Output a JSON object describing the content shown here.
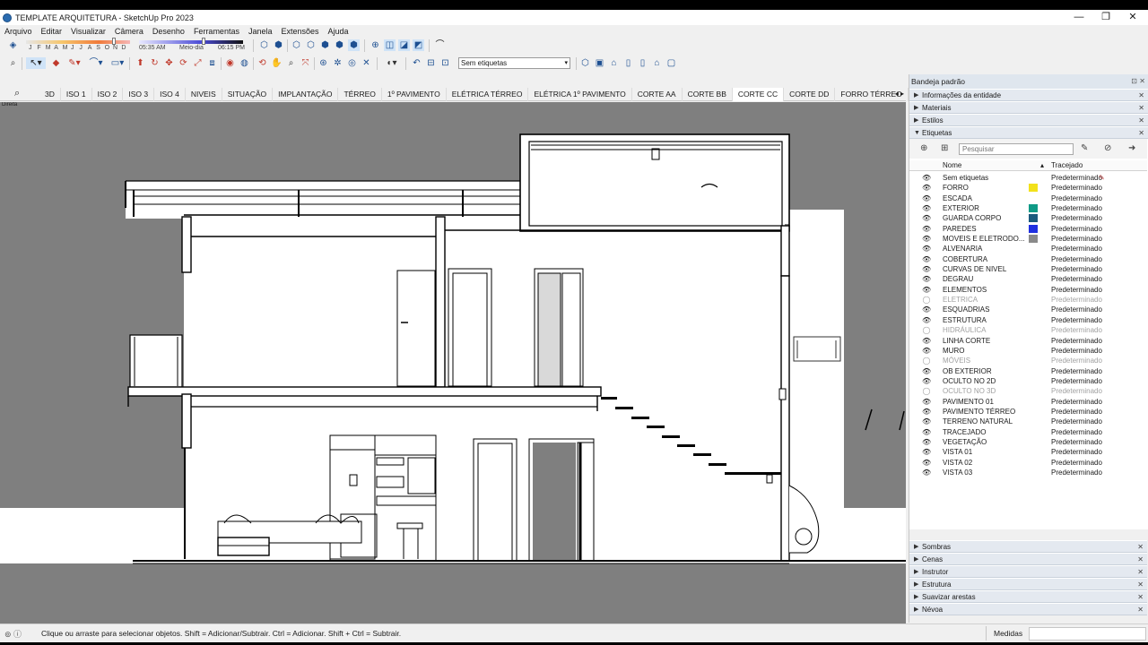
{
  "window": {
    "title": "TEMPLATE ARQUITETURA - SketchUp Pro 2023",
    "minimize": "—",
    "restore": "❐",
    "close": "✕"
  },
  "menu": [
    "Arquivo",
    "Editar",
    "Visualizar",
    "Câmera",
    "Desenho",
    "Ferramentas",
    "Janela",
    "Extensões",
    "Ajuda"
  ],
  "shadow_settings": {
    "months": [
      "J",
      "F",
      "M",
      "A",
      "M",
      "J",
      "J",
      "A",
      "S",
      "O",
      "N",
      "D"
    ],
    "time_start": "05:35 AM",
    "time_mid": "Meio-dia",
    "time_end": "06:15 PM"
  },
  "tag_select": {
    "value": "Sem etiquetas"
  },
  "scene_tabs": [
    "3D",
    "ISO 1",
    "ISO 2",
    "ISO 3",
    "ISO 4",
    "NIVEIS",
    "SITUAÇÃO",
    "IMPLANTAÇÃO",
    "TÉRREO",
    "1º PAVIMENTO",
    "ELÉTRICA TÉRREO",
    "ELÉTRICA 1º PAVIMENTO",
    "CORTE AA",
    "CORTE BB",
    "CORTE CC",
    "CORTE DD",
    "FORRO TÉRREO"
  ],
  "active_scene": "CORTE CC",
  "viewport_label": "Direita",
  "tray": {
    "title": "Bandeja padrão",
    "panels_top": [
      "Informações da entidade",
      "Materiais",
      "Estilos"
    ],
    "tags_panel_title": "Etiquetas",
    "search_placeholder": "Pesquisar",
    "col_name": "Nome",
    "col_dash": "Tracejado",
    "panels_bottom": [
      "Sombras",
      "Cenas",
      "Instrutor",
      "Estrutura",
      "Suavizar arestas",
      "Névoa"
    ]
  },
  "tags": [
    {
      "name": "Sem etiquetas",
      "visible": true,
      "color": "",
      "dash": "Predeterminado",
      "pencil": true
    },
    {
      "name": "FORRO",
      "visible": true,
      "color": "#f2e11b",
      "dash": "Predeterminado"
    },
    {
      "name": "ESCADA",
      "visible": true,
      "color": "",
      "dash": "Predeterminado"
    },
    {
      "name": "EXTERIOR",
      "visible": true,
      "color": "#0f9a86",
      "dash": "Predeterminado"
    },
    {
      "name": "GUARDA CORPO",
      "visible": true,
      "color": "#1b5a7d",
      "dash": "Predeterminado"
    },
    {
      "name": "PAREDES",
      "visible": true,
      "color": "#1f2fe0",
      "dash": "Predeterminado"
    },
    {
      "name": "MOVEIS E ELETRODO...",
      "visible": true,
      "color": "#8a8a8a",
      "dash": "Predeterminado"
    },
    {
      "name": "ALVENARIA",
      "visible": true,
      "color": "",
      "dash": "Predeterminado"
    },
    {
      "name": "COBERTURA",
      "visible": true,
      "color": "",
      "dash": "Predeterminado"
    },
    {
      "name": "CURVAS DE NIVEL",
      "visible": true,
      "color": "",
      "dash": "Predeterminado"
    },
    {
      "name": "DEGRAU",
      "visible": true,
      "color": "",
      "dash": "Predeterminado"
    },
    {
      "name": "ELEMENTOS",
      "visible": true,
      "color": "",
      "dash": "Predeterminado"
    },
    {
      "name": "ELETRICA",
      "visible": false,
      "color": "",
      "dash": "Predeterminado"
    },
    {
      "name": "ESQUADRIAS",
      "visible": true,
      "color": "",
      "dash": "Predeterminado"
    },
    {
      "name": "ESTRUTURA",
      "visible": true,
      "color": "",
      "dash": "Predeterminado"
    },
    {
      "name": "HIDRÁULICA",
      "visible": false,
      "color": "",
      "dash": "Predeterminado"
    },
    {
      "name": "LINHA CORTE",
      "visible": true,
      "color": "",
      "dash": "Predeterminado"
    },
    {
      "name": "MURO",
      "visible": true,
      "color": "",
      "dash": "Predeterminado"
    },
    {
      "name": "MÓVEIS",
      "visible": false,
      "color": "",
      "dash": "Predeterminado"
    },
    {
      "name": "OB EXTERIOR",
      "visible": true,
      "color": "",
      "dash": "Predeterminado"
    },
    {
      "name": "OCULTO NO 2D",
      "visible": true,
      "color": "",
      "dash": "Predeterminado"
    },
    {
      "name": "OCULTO NO 3D",
      "visible": false,
      "color": "",
      "dash": "Predeterminado"
    },
    {
      "name": "PAVIMENTO 01",
      "visible": true,
      "color": "",
      "dash": "Predeterminado"
    },
    {
      "name": "PAVIMENTO TÉRREO",
      "visible": true,
      "color": "",
      "dash": "Predeterminado"
    },
    {
      "name": "TERRENO NATURAL",
      "visible": true,
      "color": "",
      "dash": "Predeterminado"
    },
    {
      "name": "TRACEJADO",
      "visible": true,
      "color": "",
      "dash": "Predeterminado"
    },
    {
      "name": "VEGETAÇÃO",
      "visible": true,
      "color": "",
      "dash": "Predeterminado"
    },
    {
      "name": "VISTA 01",
      "visible": true,
      "color": "",
      "dash": "Predeterminado"
    },
    {
      "name": "VISTA 02",
      "visible": true,
      "color": "",
      "dash": "Predeterminado"
    },
    {
      "name": "VISTA 03",
      "visible": true,
      "color": "",
      "dash": "Predeterminado"
    }
  ],
  "status": {
    "message": "Clique ou arraste para selecionar objetos. Shift = Adicionar/Subtrair. Ctrl = Adicionar. Shift + Ctrl = Subtrair.",
    "measure_label": "Medidas"
  }
}
